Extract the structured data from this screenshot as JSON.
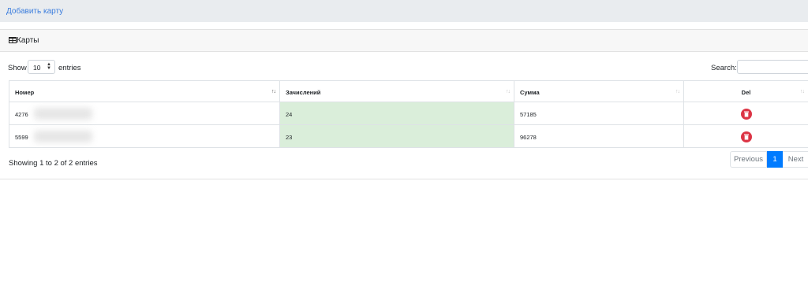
{
  "topbar": {
    "add_card_link": "Добавить карту"
  },
  "card": {
    "title": "Карты"
  },
  "controls": {
    "show": "Show",
    "page_length": "10",
    "entries": "entries",
    "search_label": "Search:",
    "search_value": ""
  },
  "table": {
    "columns": [
      "Номер",
      "Зачислений",
      "Сумма",
      "Del"
    ],
    "rows": [
      {
        "number": "4276",
        "credits": "24",
        "amount": "57185"
      },
      {
        "number": "5599",
        "credits": "23",
        "amount": "96278"
      }
    ]
  },
  "footer": {
    "info": "Showing 1 to 2 of 2 entries",
    "prev": "Previous",
    "page": "1",
    "next": "Next"
  },
  "icons": {
    "table": "table-icon",
    "delete": "trash-icon",
    "sort": "sort-icon"
  },
  "colors": {
    "link": "#3b7ddd",
    "highlight": "#daeeda",
    "delete": "#dc3545",
    "active_page": "#007bff"
  }
}
